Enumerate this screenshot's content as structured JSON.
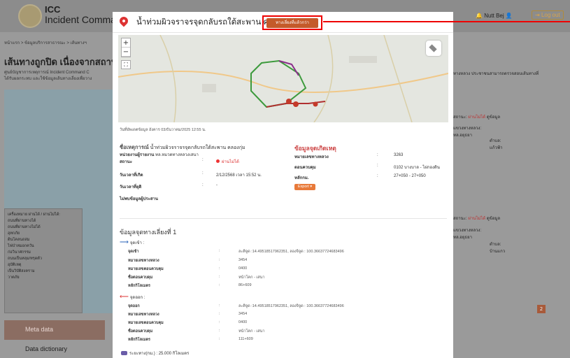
{
  "background": {
    "app_title_line1": "ICC",
    "app_title_line2": "Incident Command C",
    "user_name": "Nutt Bej",
    "logout": "Log out",
    "breadcrumb": "หน้าแรก > ข้อมูลบริการสาธารณะ > เส้นทางฯ",
    "page_heading": "เส้นทางถูกปิด เนื่องจากสถานการ",
    "description_line1": "ศูนย์บัญชาการเหตุการณ์ Incident Command C",
    "description_line2": "ได้รับผลกระทบ และใช้ข้อมูลเส้นทางเลี่ยงเพื่อวาง",
    "right_note": "ทางหลวง ประชาชนสามารถตรวจสอบเส้นทางที่",
    "status_label": "สถานะ:",
    "status_value": "ผ่านไม่ได้",
    "info_link": "ดูข้อมูล",
    "region_label_1": "แขวงทางหลวง:",
    "region_value_1": "ทล.อยุธยา",
    "district_label_1": "ตำบล:",
    "district_value_1": "แก้วฟ้า",
    "region_label_2": "แขวงทางหลวง:",
    "region_value_2": "ทล.อยุธยา",
    "district_label_2": "ตำบล:",
    "district_value_2": "บ้านแกว",
    "legend_title": "เครื่องหมาย ผ่านได้ / ผ่านไม่ได้:",
    "legend_items": [
      "ถนนที่ผ่านทางได้",
      "ถนนที่ผ่านทางไม่ได้",
      "อุทกภัย",
      "ดินโคลนถล่ม",
      "ไฟป่าหมอกควัน",
      "ก่อวินาศกรรม",
      "ถนนเป็นหลุม/ทรุดตัว",
      "อุบัติเหตุ",
      "เป็นวิบัติสงคราม",
      "วาตภัย"
    ],
    "meta_data": "Meta data",
    "data_dictionary": "Data dictionary",
    "page_next": "2"
  },
  "modal": {
    "title": "น้ำท่วมผิวจราจรจุดกลับรถใต้สะพาน คลองกุ่ม",
    "prev_button": "ทางเลี่ยงที่แล้วกว่า",
    "updated_text": "วันที่อัพเดตข้อมูล   อังคาร 03/ธันวาคม/2025 12:55 น.",
    "incident_label": "ชื่อเหตุการณ์",
    "incident_value": "น้ำท่วมผิวจราจรจุดกลับรถใต้สะพาน คลองกุ่ม",
    "reporter_label": "หน่วยงานผู้รายงาน",
    "reporter_value": "ทล.หมวดทางหลวงเสนา",
    "status_label": "สถานะ",
    "status_value": "ผ่านไม่ได้",
    "start_label": "วันเวลาที่เกิด",
    "start_value": "2/12/2568 เวลา 15:52 น.",
    "end_label": "วันเวลาที่ยุติ",
    "end_value": "-",
    "no_affected": "ไม่พบข้อมูลผู้ประสาน",
    "location_title": "ข้อมูลจุดเกิดเหตุ",
    "highway_label": "หมายเลขทางหลวง",
    "highway_value": "3263",
    "control_label": "ตอนควบคุม",
    "control_value": "0102 บางบาล - ไผ่กองดิน",
    "km_label": "หลักกม.",
    "km_value": "27+050 - 27+050",
    "export_label": "Export",
    "detour_title": "ข้อมูลจุดทางเลี่ยงที่ 1",
    "entry_label": "จุดเข้า :",
    "exit_label": "จุดออก :",
    "point_label": "จุดเข้า",
    "point_out_label": "จุดออก",
    "highway_no_label": "หมายเลขทางหลวง",
    "control_no_label": "หมายเลขตอนควบคุม",
    "control_name_label": "ชื่อตอนควบคุม",
    "km_marker_label": "หลักกิโลเมตร",
    "entry_point": "ละติจูด :14.49518517962351, ลองจิจูด : 100.36637724683496",
    "entry_highway": "3454",
    "entry_control_no": "0400",
    "entry_control_name": "หน้าโคก - เสนา",
    "entry_km": "86+609",
    "exit_point": "ละติจูด :14.49518517962351, ลองจิจูด : 100.36637724683496",
    "exit_highway": "3454",
    "exit_control_no": "0400",
    "exit_control_name": "หน้าโคก - เสนา",
    "exit_km": "111+609",
    "distance": "ระยะทาง(กม.) : 25.000 กิโลเมตร"
  }
}
